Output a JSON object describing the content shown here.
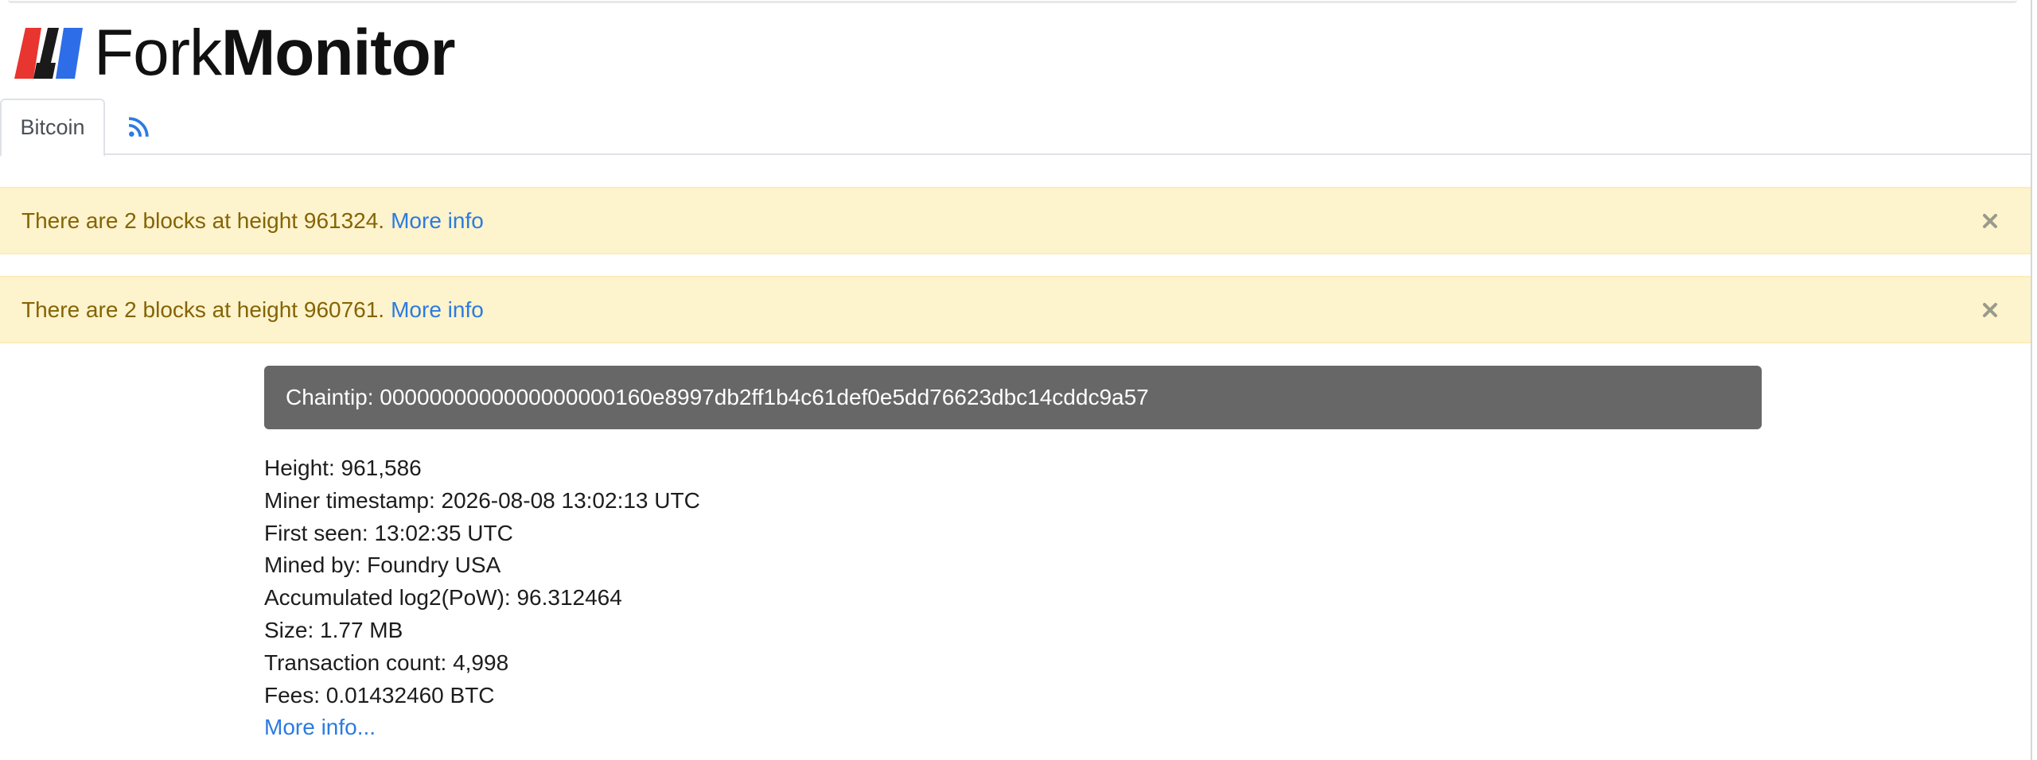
{
  "brand": {
    "name_light": "Fork",
    "name_bold": "Monitor",
    "logo_colors": {
      "red": "#e8352f",
      "dark": "#1a1a1a",
      "blue": "#2d6ee8"
    }
  },
  "tabs": [
    {
      "label": "Bitcoin",
      "active": true
    },
    {
      "icon": "rss-icon"
    }
  ],
  "alerts": [
    {
      "text": "There are 2 blocks at height 961324.",
      "link": "More info"
    },
    {
      "text": "There are 2 blocks at height 960761.",
      "link": "More info"
    }
  ],
  "chaintip": {
    "label": "Chaintip: 0000000000000000000160e8997db2ff1b4c61def0e5dd76623dbc14cddc9a57"
  },
  "block": {
    "height": "Height: 961,586",
    "miner_timestamp": "Miner timestamp: 2026-08-08 13:02:13 UTC",
    "first_seen": "First seen: 13:02:35 UTC",
    "mined_by": "Mined by: Foundry USA",
    "accumulated_pow": "Accumulated log2(PoW): 96.312464",
    "size": "Size: 1.77 MB",
    "tx_count": "Transaction count: 4,998",
    "fees": "Fees: 0.01432460 BTC",
    "more_link": "More info..."
  },
  "colors": {
    "alert_bg": "#fdf3cd",
    "alert_text": "#856404",
    "link": "#2b7be0",
    "chaintip_bg": "#676767"
  }
}
